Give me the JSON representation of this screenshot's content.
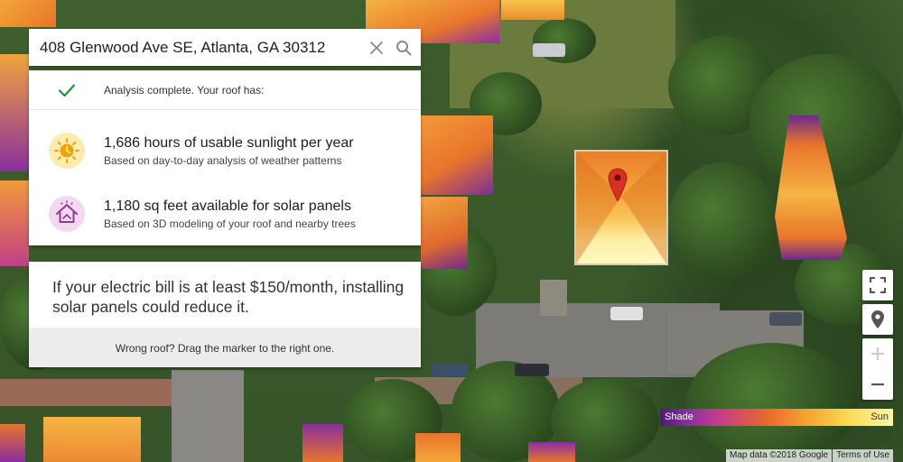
{
  "search": {
    "value": "408 Glenwood Ave SE, Atlanta, GA 30312"
  },
  "analysis": {
    "status": "Analysis complete. Your roof has:",
    "sunlight": {
      "title": "1,686 hours of usable sunlight per year",
      "subtitle": "Based on day-to-day analysis of weather patterns",
      "icon": "sun-clock-icon"
    },
    "area": {
      "title": "1,180 sq feet available for solar panels",
      "subtitle": "Based on 3D modeling of your roof and nearby trees",
      "icon": "house-roof-icon"
    }
  },
  "bill": {
    "text": "If your electric bill is at least $150/month, installing solar panels could reduce it."
  },
  "footer": {
    "wrong_roof": "Wrong roof? Drag the marker to the right one."
  },
  "legend": {
    "shade": "Shade",
    "sun": "Sun"
  },
  "attribution": {
    "map_data": "Map data ©2018 Google",
    "terms": "Terms of Use"
  },
  "colors": {
    "check": "#1e8e3e",
    "sun_icon_bg": "#fdebb0",
    "sun_icon": "#f0a400",
    "house_icon_bg": "#f2d9ef",
    "house_icon": "#8e3a9a",
    "marker": "#d93025"
  }
}
